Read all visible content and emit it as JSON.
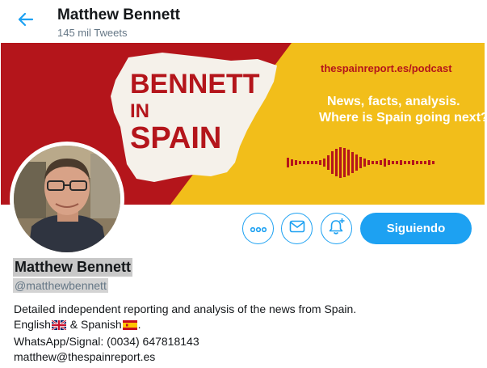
{
  "header": {
    "title": "Matthew Bennett",
    "tweet_count": "145 mil Tweets",
    "back_icon": "arrow-left-icon"
  },
  "banner": {
    "brand_line1": "BENNETT",
    "brand_line2": "IN",
    "brand_line3": "SPAIN",
    "url": "thespainreport.es/podcast",
    "tagline1": "News, facts, analysis.",
    "tagline2": "Where is Spain going next?",
    "colors": {
      "red": "#b4151b",
      "yellow": "#f2be1a",
      "map": "#f5f1ea"
    }
  },
  "actions": {
    "more_icon": "more-options-icon",
    "message_icon": "envelope-icon",
    "notify_icon": "bell-plus-icon",
    "follow_label": "Siguiendo",
    "accent": "#1da1f2"
  },
  "profile": {
    "name": "Matthew Bennett",
    "handle": "@matthewbennett"
  },
  "bio": {
    "line1": "Detailed independent reporting and analysis of the news from Spain.",
    "line2_a": "English",
    "line2_b": " & Spanish",
    "line2_c": ".",
    "line3": "WhatsApp/Signal: (0034) 647818143",
    "line4": "matthew@thespainreport.es"
  }
}
